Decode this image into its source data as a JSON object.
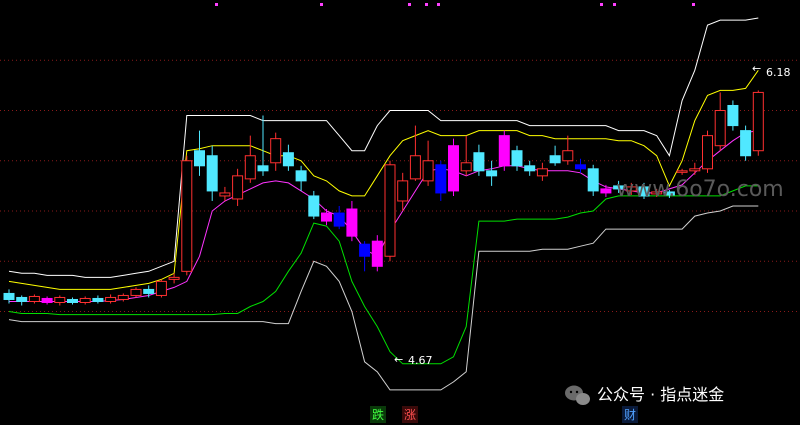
{
  "chart_data": {
    "type": "candlestick",
    "title": "",
    "xlabel": "",
    "ylabel": "",
    "ylim": [
      3.1,
      7.0
    ],
    "grid": true,
    "annotations": {
      "high_label": "6.18",
      "low_label": "4.67",
      "high_arrow": "←",
      "low_arrow": "←"
    },
    "bottom_markers": [
      "跌",
      "涨",
      "财"
    ],
    "watermark": "www.6o7o.com",
    "source_label": "公众号 · 指点迷金",
    "colors": {
      "up": "#ff3030",
      "down": "#50e8ff",
      "limit_up": "#ff00ff",
      "limit_down": "#0000ff",
      "upper_outer": "#ffffff",
      "upper_inner": "#ffff00",
      "middle": "#ff33ff",
      "lower_inner": "#00e000",
      "lower_outer": "#d0d0d0",
      "grid": "#8a1a1a"
    },
    "candles": [
      {
        "o": 4.18,
        "c": 4.12,
        "h": 4.22,
        "l": 4.08
      },
      {
        "o": 4.14,
        "c": 4.1,
        "h": 4.16,
        "l": 4.06
      },
      {
        "o": 4.1,
        "c": 4.15,
        "h": 4.17,
        "l": 4.08
      },
      {
        "o": 4.13,
        "c": 4.09,
        "h": 4.15,
        "l": 4.07,
        "kind": "limit_up"
      },
      {
        "o": 4.09,
        "c": 4.14,
        "h": 4.16,
        "l": 4.06
      },
      {
        "o": 4.12,
        "c": 4.09,
        "h": 4.14,
        "l": 4.07
      },
      {
        "o": 4.09,
        "c": 4.13,
        "h": 4.15,
        "l": 4.07
      },
      {
        "o": 4.13,
        "c": 4.1,
        "h": 4.16,
        "l": 4.08
      },
      {
        "o": 4.1,
        "c": 4.14,
        "h": 4.17,
        "l": 4.08
      },
      {
        "o": 4.12,
        "c": 4.16,
        "h": 4.18,
        "l": 4.1
      },
      {
        "o": 4.16,
        "c": 4.22,
        "h": 4.24,
        "l": 4.14
      },
      {
        "o": 4.22,
        "c": 4.18,
        "h": 4.26,
        "l": 4.14
      },
      {
        "o": 4.16,
        "c": 4.3,
        "h": 4.32,
        "l": 4.14
      },
      {
        "o": 4.32,
        "c": 4.34,
        "h": 4.38,
        "l": 4.28
      },
      {
        "o": 4.4,
        "c": 5.5,
        "h": 5.55,
        "l": 4.36
      },
      {
        "o": 5.6,
        "c": 5.45,
        "h": 5.8,
        "l": 5.35
      },
      {
        "o": 5.55,
        "c": 5.2,
        "h": 5.65,
        "l": 5.1
      },
      {
        "o": 5.15,
        "c": 5.18,
        "h": 5.24,
        "l": 5.1
      },
      {
        "o": 5.12,
        "c": 5.35,
        "h": 5.42,
        "l": 5.05
      },
      {
        "o": 5.32,
        "c": 5.55,
        "h": 5.75,
        "l": 5.28
      },
      {
        "o": 5.45,
        "c": 5.4,
        "h": 5.95,
        "l": 5.35
      },
      {
        "o": 5.48,
        "c": 5.72,
        "h": 5.78,
        "l": 5.4
      },
      {
        "o": 5.58,
        "c": 5.45,
        "h": 5.66,
        "l": 5.4
      },
      {
        "o": 5.4,
        "c": 5.3,
        "h": 5.45,
        "l": 5.2
      },
      {
        "o": 5.15,
        "c": 4.95,
        "h": 5.2,
        "l": 4.92
      },
      {
        "o": 4.98,
        "c": 4.9,
        "h": 5.02,
        "l": 4.86,
        "kind": "limit_up"
      },
      {
        "o": 4.98,
        "c": 4.85,
        "h": 5.05,
        "l": 4.82,
        "kind": "limit_down"
      },
      {
        "o": 4.75,
        "c": 5.02,
        "h": 5.1,
        "l": 4.7,
        "kind": "limit_up"
      },
      {
        "o": 4.55,
        "c": 4.67,
        "h": 4.7,
        "l": 4.4,
        "kind": "limit_down"
      },
      {
        "o": 4.45,
        "c": 4.7,
        "h": 4.76,
        "l": 4.4,
        "kind": "limit_up"
      },
      {
        "o": 4.55,
        "c": 5.46,
        "h": 5.5,
        "l": 4.5
      },
      {
        "o": 5.1,
        "c": 5.3,
        "h": 5.38,
        "l": 5.0
      },
      {
        "o": 5.32,
        "c": 5.55,
        "h": 5.85,
        "l": 5.3
      },
      {
        "o": 5.3,
        "c": 5.5,
        "h": 5.7,
        "l": 5.25
      },
      {
        "o": 5.18,
        "c": 5.46,
        "h": 5.5,
        "l": 5.1,
        "kind": "limit_down"
      },
      {
        "o": 5.2,
        "c": 5.65,
        "h": 5.72,
        "l": 5.15,
        "kind": "limit_up"
      },
      {
        "o": 5.4,
        "c": 5.48,
        "h": 5.75,
        "l": 5.35
      },
      {
        "o": 5.58,
        "c": 5.4,
        "h": 5.66,
        "l": 5.35
      },
      {
        "o": 5.4,
        "c": 5.35,
        "h": 5.5,
        "l": 5.25
      },
      {
        "o": 5.45,
        "c": 5.75,
        "h": 5.8,
        "l": 5.4,
        "kind": "limit_up"
      },
      {
        "o": 5.6,
        "c": 5.45,
        "h": 5.65,
        "l": 5.4
      },
      {
        "o": 5.45,
        "c": 5.4,
        "h": 5.5,
        "l": 5.35
      },
      {
        "o": 5.35,
        "c": 5.42,
        "h": 5.48,
        "l": 5.3
      },
      {
        "o": 5.55,
        "c": 5.48,
        "h": 5.65,
        "l": 5.45
      },
      {
        "o": 5.5,
        "c": 5.6,
        "h": 5.75,
        "l": 5.46
      },
      {
        "o": 5.46,
        "c": 5.42,
        "h": 5.52,
        "l": 5.38,
        "kind": "limit_down"
      },
      {
        "o": 5.42,
        "c": 5.2,
        "h": 5.46,
        "l": 5.15
      },
      {
        "o": 5.22,
        "c": 5.18,
        "h": 5.26,
        "l": 5.14,
        "kind": "limit_up"
      },
      {
        "o": 5.25,
        "c": 5.22,
        "h": 5.3,
        "l": 5.18
      },
      {
        "o": 5.2,
        "c": 5.24,
        "h": 5.28,
        "l": 5.16
      },
      {
        "o": 5.24,
        "c": 5.15,
        "h": 5.28,
        "l": 5.12
      },
      {
        "o": 5.17,
        "c": 5.19,
        "h": 5.22,
        "l": 5.14
      },
      {
        "o": 5.19,
        "c": 5.16,
        "h": 5.21,
        "l": 5.13
      },
      {
        "o": 5.4,
        "c": 5.4,
        "h": 5.42,
        "l": 5.36
      },
      {
        "o": 5.4,
        "c": 5.42,
        "h": 5.48,
        "l": 5.36
      },
      {
        "o": 5.42,
        "c": 5.75,
        "h": 5.8,
        "l": 5.38
      },
      {
        "o": 5.65,
        "c": 6.0,
        "h": 6.18,
        "l": 5.6
      },
      {
        "o": 6.05,
        "c": 5.85,
        "h": 6.1,
        "l": 5.8
      },
      {
        "o": 5.8,
        "c": 5.55,
        "h": 5.85,
        "l": 5.5
      },
      {
        "o": 5.6,
        "c": 6.18,
        "h": 6.2,
        "l": 5.55
      }
    ],
    "series": [
      {
        "role": "upper_outer",
        "values": [
          4.4,
          4.38,
          4.38,
          4.36,
          4.36,
          4.36,
          4.34,
          4.34,
          4.34,
          4.36,
          4.38,
          4.4,
          4.45,
          4.5,
          5.95,
          5.95,
          5.95,
          5.95,
          5.95,
          5.95,
          5.9,
          5.9,
          5.9,
          5.9,
          5.9,
          5.9,
          5.75,
          5.6,
          5.6,
          5.85,
          6.0,
          6.0,
          6.0,
          6.0,
          5.9,
          5.9,
          5.9,
          5.9,
          5.9,
          5.9,
          5.9,
          5.85,
          5.85,
          5.85,
          5.85,
          5.85,
          5.85,
          5.85,
          5.8,
          5.8,
          5.8,
          5.75,
          5.55,
          6.1,
          6.4,
          6.85,
          6.9,
          6.9,
          6.9,
          6.92
        ]
      },
      {
        "role": "upper_inner",
        "values": [
          4.3,
          4.28,
          4.26,
          4.24,
          4.22,
          4.22,
          4.22,
          4.22,
          4.22,
          4.24,
          4.26,
          4.28,
          4.32,
          4.38,
          5.6,
          5.62,
          5.65,
          5.65,
          5.65,
          5.65,
          5.6,
          5.55,
          5.55,
          5.5,
          5.35,
          5.3,
          5.2,
          5.15,
          5.15,
          5.35,
          5.55,
          5.7,
          5.75,
          5.8,
          5.75,
          5.75,
          5.75,
          5.8,
          5.8,
          5.8,
          5.8,
          5.75,
          5.75,
          5.72,
          5.72,
          5.72,
          5.72,
          5.72,
          5.7,
          5.7,
          5.65,
          5.55,
          5.25,
          5.5,
          5.9,
          6.15,
          6.2,
          6.2,
          6.22,
          6.4
        ]
      },
      {
        "role": "middle",
        "values": [
          4.1,
          4.1,
          4.1,
          4.1,
          4.1,
          4.1,
          4.1,
          4.1,
          4.11,
          4.12,
          4.14,
          4.16,
          4.2,
          4.24,
          4.3,
          4.55,
          5.0,
          5.1,
          5.16,
          5.22,
          5.28,
          5.3,
          5.28,
          5.2,
          5.12,
          5.0,
          4.95,
          4.8,
          4.62,
          4.55,
          4.8,
          5.0,
          5.2,
          5.4,
          5.42,
          5.4,
          5.35,
          5.4,
          5.42,
          5.45,
          5.45,
          5.42,
          5.4,
          5.4,
          5.4,
          5.38,
          5.3,
          5.24,
          5.22,
          5.2,
          5.18,
          5.18,
          5.22,
          5.26,
          5.38,
          5.5,
          5.6,
          5.7,
          5.78,
          5.8
        ]
      },
      {
        "role": "lower_inner",
        "values": [
          4.0,
          3.98,
          3.98,
          3.98,
          3.97,
          3.97,
          3.97,
          3.97,
          3.97,
          3.97,
          3.97,
          3.97,
          3.97,
          3.97,
          3.97,
          3.97,
          3.97,
          3.98,
          3.98,
          4.05,
          4.1,
          4.2,
          4.4,
          4.58,
          4.88,
          4.85,
          4.7,
          4.3,
          4.05,
          3.85,
          3.6,
          3.48,
          3.48,
          3.48,
          3.48,
          3.55,
          3.85,
          4.9,
          4.9,
          4.9,
          4.92,
          4.92,
          4.92,
          4.92,
          4.94,
          4.98,
          5.0,
          5.12,
          5.15,
          5.15,
          5.15,
          5.15,
          5.15,
          5.15,
          5.15,
          5.15,
          5.15,
          5.2,
          5.25,
          5.25
        ]
      },
      {
        "role": "lower_outer",
        "values": [
          3.92,
          3.9,
          3.9,
          3.9,
          3.9,
          3.9,
          3.9,
          3.9,
          3.9,
          3.9,
          3.9,
          3.9,
          3.9,
          3.9,
          3.9,
          3.9,
          3.9,
          3.9,
          3.9,
          3.9,
          3.9,
          3.88,
          3.88,
          4.2,
          4.5,
          4.45,
          4.3,
          4.0,
          3.5,
          3.4,
          3.22,
          3.22,
          3.22,
          3.22,
          3.22,
          3.3,
          3.4,
          4.6,
          4.6,
          4.6,
          4.6,
          4.6,
          4.62,
          4.62,
          4.62,
          4.65,
          4.68,
          4.82,
          4.82,
          4.82,
          4.82,
          4.82,
          4.82,
          4.82,
          4.95,
          4.98,
          5.0,
          5.05,
          5.05,
          5.05
        ]
      }
    ]
  }
}
